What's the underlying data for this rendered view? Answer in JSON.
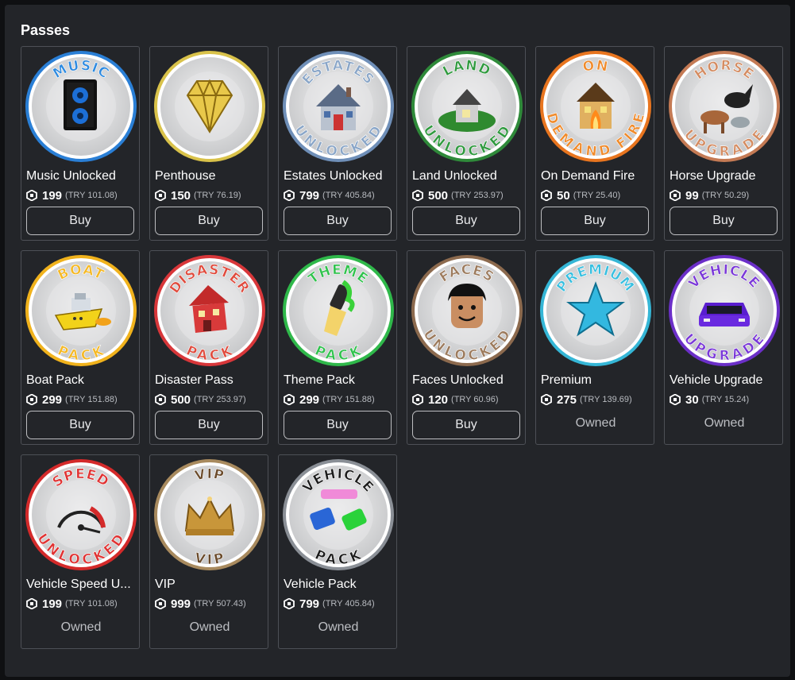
{
  "section": {
    "title": "Passes"
  },
  "passes": [
    {
      "name": "Music Unlocked",
      "price": "199",
      "local_price": "(TRY 101.08)",
      "status": "buy",
      "action_label": "Buy",
      "badge_top": "MUSIC",
      "badge_bottom": "",
      "ring_color": "#2a7fd6",
      "top_color": "#2d8ae0",
      "bottom_color": "#2d8ae0",
      "icon": "speaker-icon"
    },
    {
      "name": "Penthouse",
      "price": "150",
      "local_price": "(TRY 76.19)",
      "status": "buy",
      "action_label": "Buy",
      "badge_top": "",
      "badge_bottom": "",
      "ring_color": "#d9c24a",
      "top_color": "#d9c24a",
      "bottom_color": "#d9c24a",
      "icon": "diamond-icon"
    },
    {
      "name": "Estates Unlocked",
      "price": "799",
      "local_price": "(TRY 405.84)",
      "status": "buy",
      "action_label": "Buy",
      "badge_top": "ESTATES",
      "badge_bottom": "UNLOCKED",
      "ring_color": "#6f8fb8",
      "top_color": "#8aa6c8",
      "bottom_color": "#8aa6c8",
      "icon": "estate-house-icon"
    },
    {
      "name": "Land Unlocked",
      "price": "500",
      "local_price": "(TRY 253.97)",
      "status": "buy",
      "action_label": "Buy",
      "badge_top": "LAND",
      "badge_bottom": "UNLOCKED",
      "ring_color": "#2f8a3a",
      "top_color": "#2f9a3e",
      "bottom_color": "#2f9a3e",
      "icon": "land-house-icon"
    },
    {
      "name": "On Demand Fire",
      "price": "50",
      "local_price": "(TRY 25.40)",
      "status": "buy",
      "action_label": "Buy",
      "badge_top": "ON",
      "badge_bottom": "DEMAND FIRE",
      "ring_color": "#e8751f",
      "top_color": "#f08a2a",
      "bottom_color": "#f08a2a",
      "icon": "burning-house-icon"
    },
    {
      "name": "Horse Upgrade",
      "price": "99",
      "local_price": "(TRY 50.29)",
      "status": "buy",
      "action_label": "Buy",
      "badge_top": "HORSE",
      "badge_bottom": "UPGRADE",
      "ring_color": "#c47a54",
      "top_color": "#d48c62",
      "bottom_color": "#d48c62",
      "icon": "horse-icon"
    },
    {
      "name": "Boat Pack",
      "price": "299",
      "local_price": "(TRY 151.88)",
      "status": "buy",
      "action_label": "Buy",
      "badge_top": "BOAT",
      "badge_bottom": "PACK",
      "ring_color": "#f0b21c",
      "top_color": "#f5b824",
      "bottom_color": "#f5b824",
      "icon": "boat-icon"
    },
    {
      "name": "Disaster Pass",
      "price": "500",
      "local_price": "(TRY 253.97)",
      "status": "buy",
      "action_label": "Buy",
      "badge_top": "DISASTER",
      "badge_bottom": "PACK",
      "ring_color": "#d8373a",
      "top_color": "#e04a3c",
      "bottom_color": "#e04a3c",
      "icon": "disaster-house-icon"
    },
    {
      "name": "Theme Pack",
      "price": "299",
      "local_price": "(TRY 151.88)",
      "status": "buy",
      "action_label": "Buy",
      "badge_top": "THEME",
      "badge_bottom": "PACK",
      "ring_color": "#2fb84a",
      "top_color": "#2fc24c",
      "bottom_color": "#2fc24c",
      "icon": "paintbrush-icon"
    },
    {
      "name": "Faces Unlocked",
      "price": "120",
      "local_price": "(TRY 60.96)",
      "status": "buy",
      "action_label": "Buy",
      "badge_top": "FACES",
      "badge_bottom": "UNLOCKED",
      "ring_color": "#8c6a4e",
      "top_color": "#9c7a5c",
      "bottom_color": "#9c7a5c",
      "icon": "face-icon"
    },
    {
      "name": "Premium",
      "price": "275",
      "local_price": "(TRY 139.69)",
      "status": "owned",
      "action_label": "Owned",
      "badge_top": "PREMIUM",
      "badge_bottom": "",
      "ring_color": "#35b6d6",
      "top_color": "#38bfe0",
      "bottom_color": "#38bfe0",
      "icon": "star-icon"
    },
    {
      "name": "Vehicle Upgrade",
      "price": "30",
      "local_price": "(TRY 15.24)",
      "status": "owned",
      "action_label": "Owned",
      "badge_top": "VEHICLE",
      "badge_bottom": "UPGRADE",
      "ring_color": "#6b2fc8",
      "top_color": "#7a38d8",
      "bottom_color": "#7a38d8",
      "icon": "purple-car-icon"
    },
    {
      "name": "Vehicle Speed U...",
      "price": "199",
      "local_price": "(TRY 101.08)",
      "status": "owned",
      "action_label": "Owned",
      "badge_top": "SPEED",
      "badge_bottom": "UNLOCKED",
      "ring_color": "#d42a2a",
      "top_color": "#e03232",
      "bottom_color": "#e03232",
      "icon": "speedometer-icon"
    },
    {
      "name": "VIP",
      "price": "999",
      "local_price": "(TRY 507.43)",
      "status": "owned",
      "action_label": "Owned",
      "badge_top": "VIP",
      "badge_bottom": "VIP",
      "ring_color": "#a88a5e",
      "top_color": "#6a4a2a",
      "bottom_color": "#6a4a2a",
      "icon": "crown-icon"
    },
    {
      "name": "Vehicle Pack",
      "price": "799",
      "local_price": "(TRY 405.84)",
      "status": "owned",
      "action_label": "Owned",
      "badge_top": "VEHICLE",
      "badge_bottom": "PACK",
      "ring_color": "#8a8f96",
      "top_color": "#1b1b1b",
      "bottom_color": "#1b1b1b",
      "icon": "cars-icon"
    }
  ]
}
